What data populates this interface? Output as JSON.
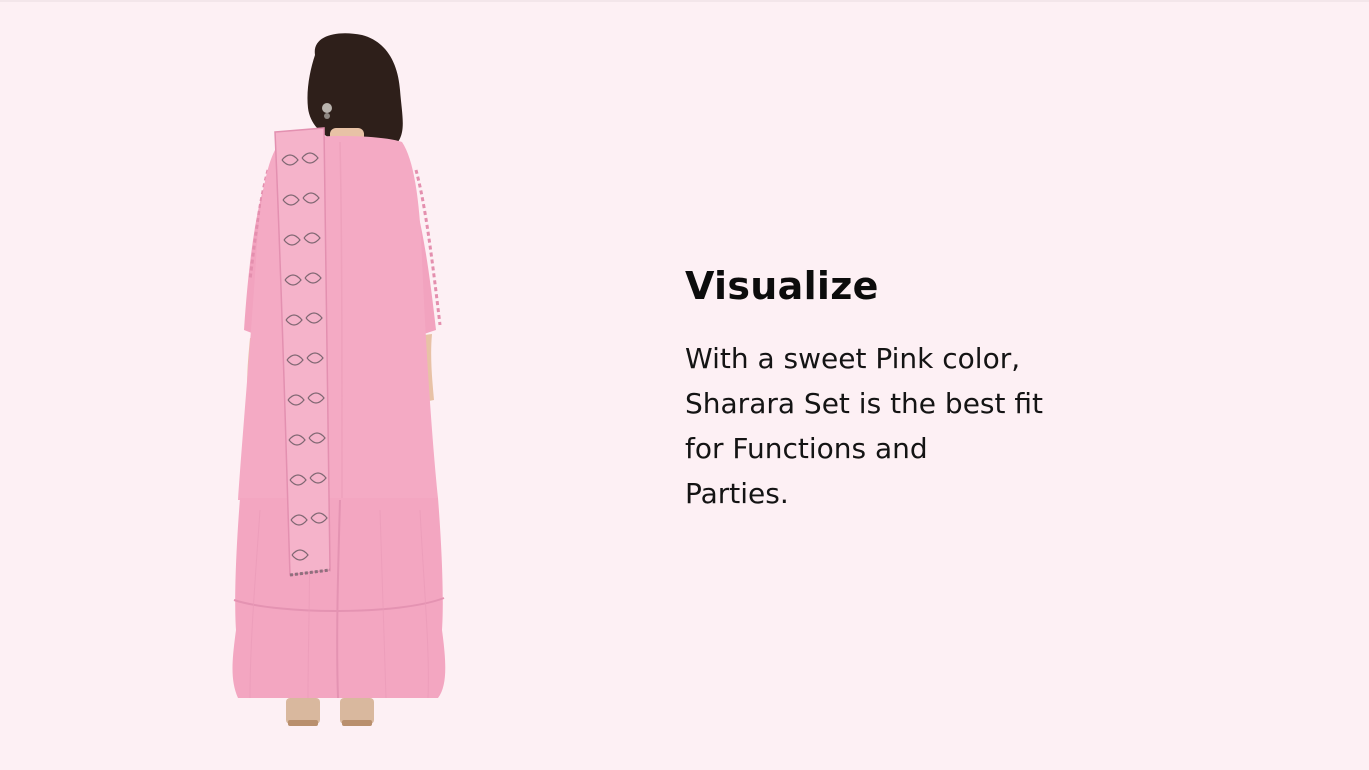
{
  "slide": {
    "background_color": "#fdf0f4",
    "heading": "Visualize",
    "body": "With a sweet Pink color,\nSharara Set is the best fit\nfor Functions and\nParties."
  },
  "product_image": {
    "subject": "woman-in-pink-sharara-set-back-view",
    "garment_color": "#f2a3bf",
    "hair_color": "#2e1f1a"
  }
}
